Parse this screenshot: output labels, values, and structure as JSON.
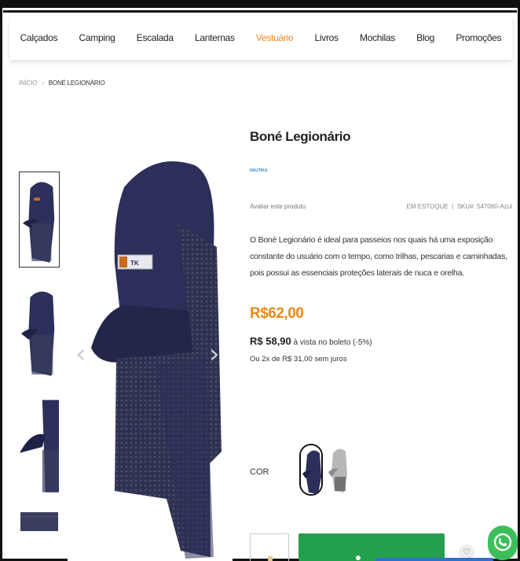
{
  "nav": {
    "items": [
      {
        "label": "Calçados"
      },
      {
        "label": "Camping"
      },
      {
        "label": "Escalada"
      },
      {
        "label": "Lanternas"
      },
      {
        "label": "Vestuário",
        "active": true
      },
      {
        "label": "Livros"
      },
      {
        "label": "Mochilas"
      },
      {
        "label": "Blog"
      },
      {
        "label": "Promoções"
      }
    ]
  },
  "breadcrumb": {
    "home": "INÍCIO",
    "separator": "›",
    "current": "BONÉ LEGIONÁRIO"
  },
  "product": {
    "title": "Boné Legionário",
    "brand_logo_text": "NAUTIKA",
    "review_link": "Avaliar este produto",
    "stock": "EM ESTOQUE",
    "sku_label": "SKU#:",
    "sku": "547080-Azul",
    "description": "O Boné Legionário é ideal para passeios nos quais há uma exposição constante do usuário com o tempo, como trilhas, pescarias e caminhadas, pois possui as essenciais proteções laterais de nuca e orelha.",
    "price": "R$62,00",
    "boleto_price": "R$ 58,90",
    "boleto_text": "à vista no boleto (-5%)",
    "installments": "Ou 2x de R$ 31,00 sem juros",
    "color_label": "COR"
  },
  "gallery": {
    "prev_icon": "‹",
    "next_icon": "›"
  },
  "actions": {
    "fav_icon": "♡"
  },
  "colors": {
    "accent": "#e8891d",
    "buy_button": "#23a04c",
    "navy": "#2b2f5a",
    "whatsapp": "#3cbf5a"
  }
}
